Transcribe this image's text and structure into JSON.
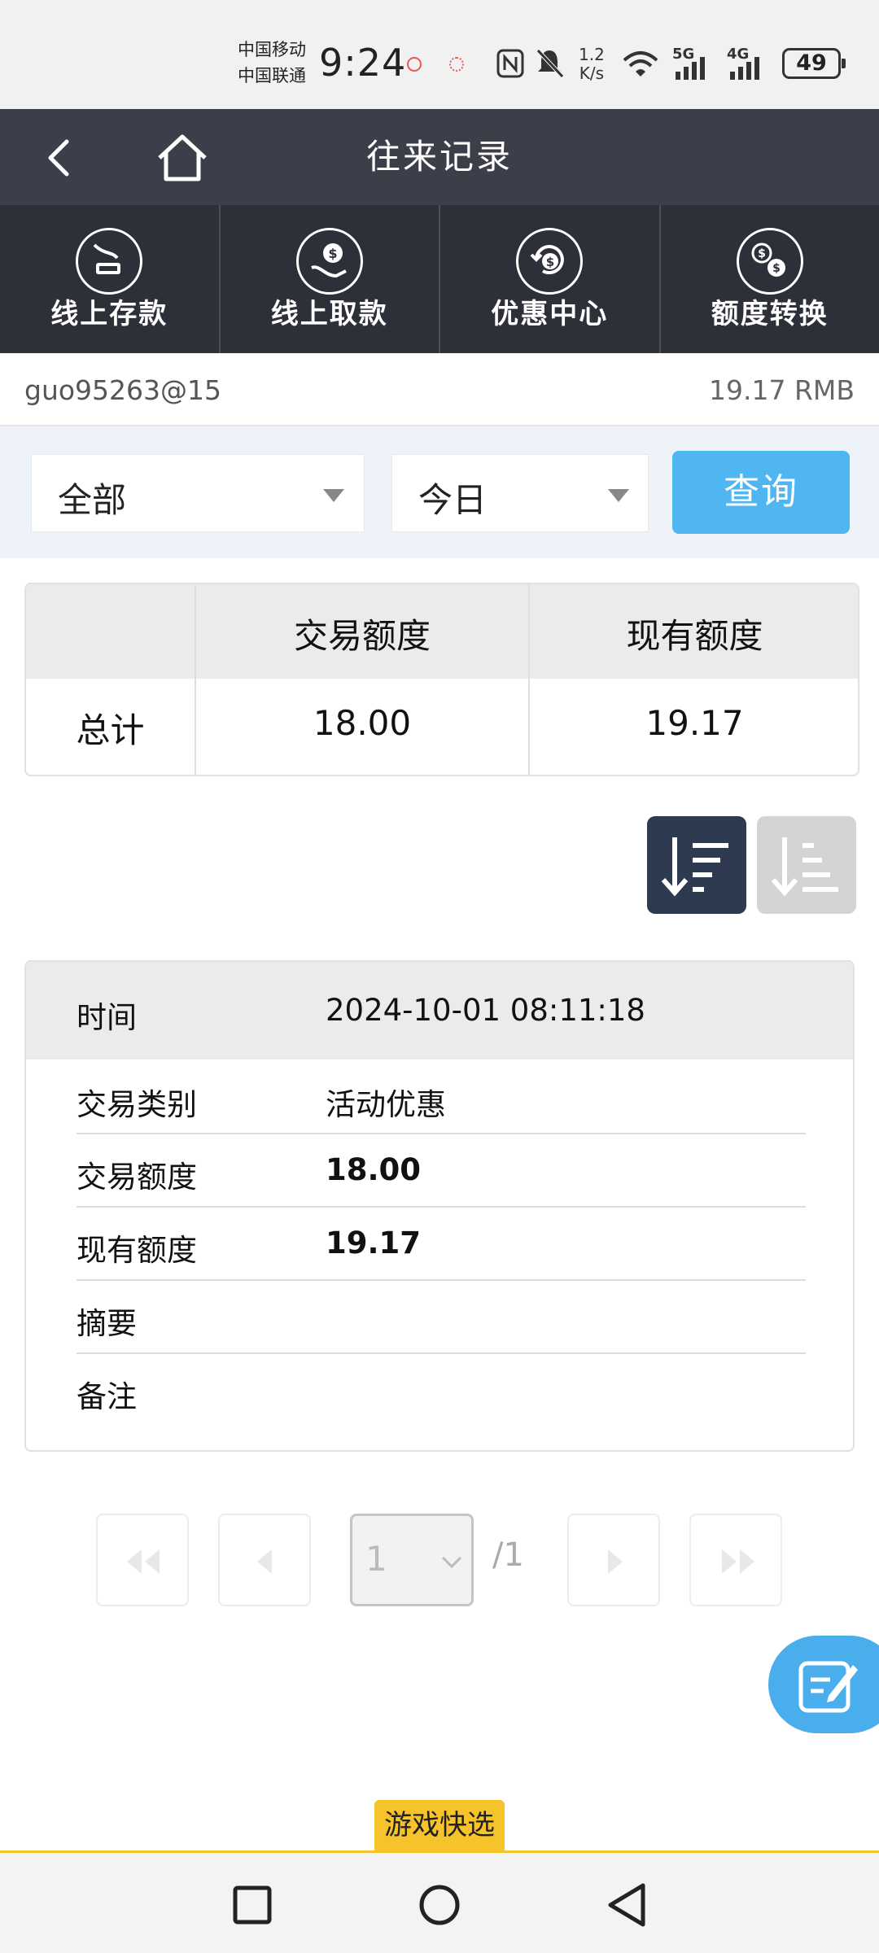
{
  "status": {
    "carrier1": "中国移动",
    "carrier2": "中国联通",
    "time": "9:24",
    "speed_value": "1.2",
    "speed_unit": "K/s",
    "net1": "5G",
    "net2": "4G",
    "battery": "49"
  },
  "header": {
    "title": "往来记录"
  },
  "nav": {
    "items": [
      {
        "label": "线上存款",
        "icon": "deposit-icon"
      },
      {
        "label": "线上取款",
        "icon": "withdraw-icon"
      },
      {
        "label": "优惠中心",
        "icon": "promo-icon"
      },
      {
        "label": "额度转换",
        "icon": "transfer-icon"
      }
    ]
  },
  "account": {
    "username": "guo95263@15",
    "balance": "19.17 RMB"
  },
  "filter": {
    "type_value": "全部",
    "date_value": "今日",
    "query_label": "查询"
  },
  "summary": {
    "col1": "交易额度",
    "col2": "现有额度",
    "row_label": "总计",
    "trade_amount": "18.00",
    "current_amount": "19.17"
  },
  "record": {
    "time_label": "时间",
    "time_value": "2024-10-01 08:11:18",
    "type_label": "交易类别",
    "type_value": "活动优惠",
    "trade_label": "交易额度",
    "trade_value": "18.00",
    "current_label": "现有额度",
    "current_value": "19.17",
    "summary_label": "摘要",
    "summary_value": "",
    "note_label": "备注",
    "note_value": ""
  },
  "pager": {
    "current_page": "1",
    "total": "/1"
  },
  "quick_select": "游戏快选",
  "colors": {
    "header_bg": "#3c3e49",
    "nav_bg": "#2e3039",
    "accent": "#50b6f2",
    "quick": "#f6c42a"
  }
}
